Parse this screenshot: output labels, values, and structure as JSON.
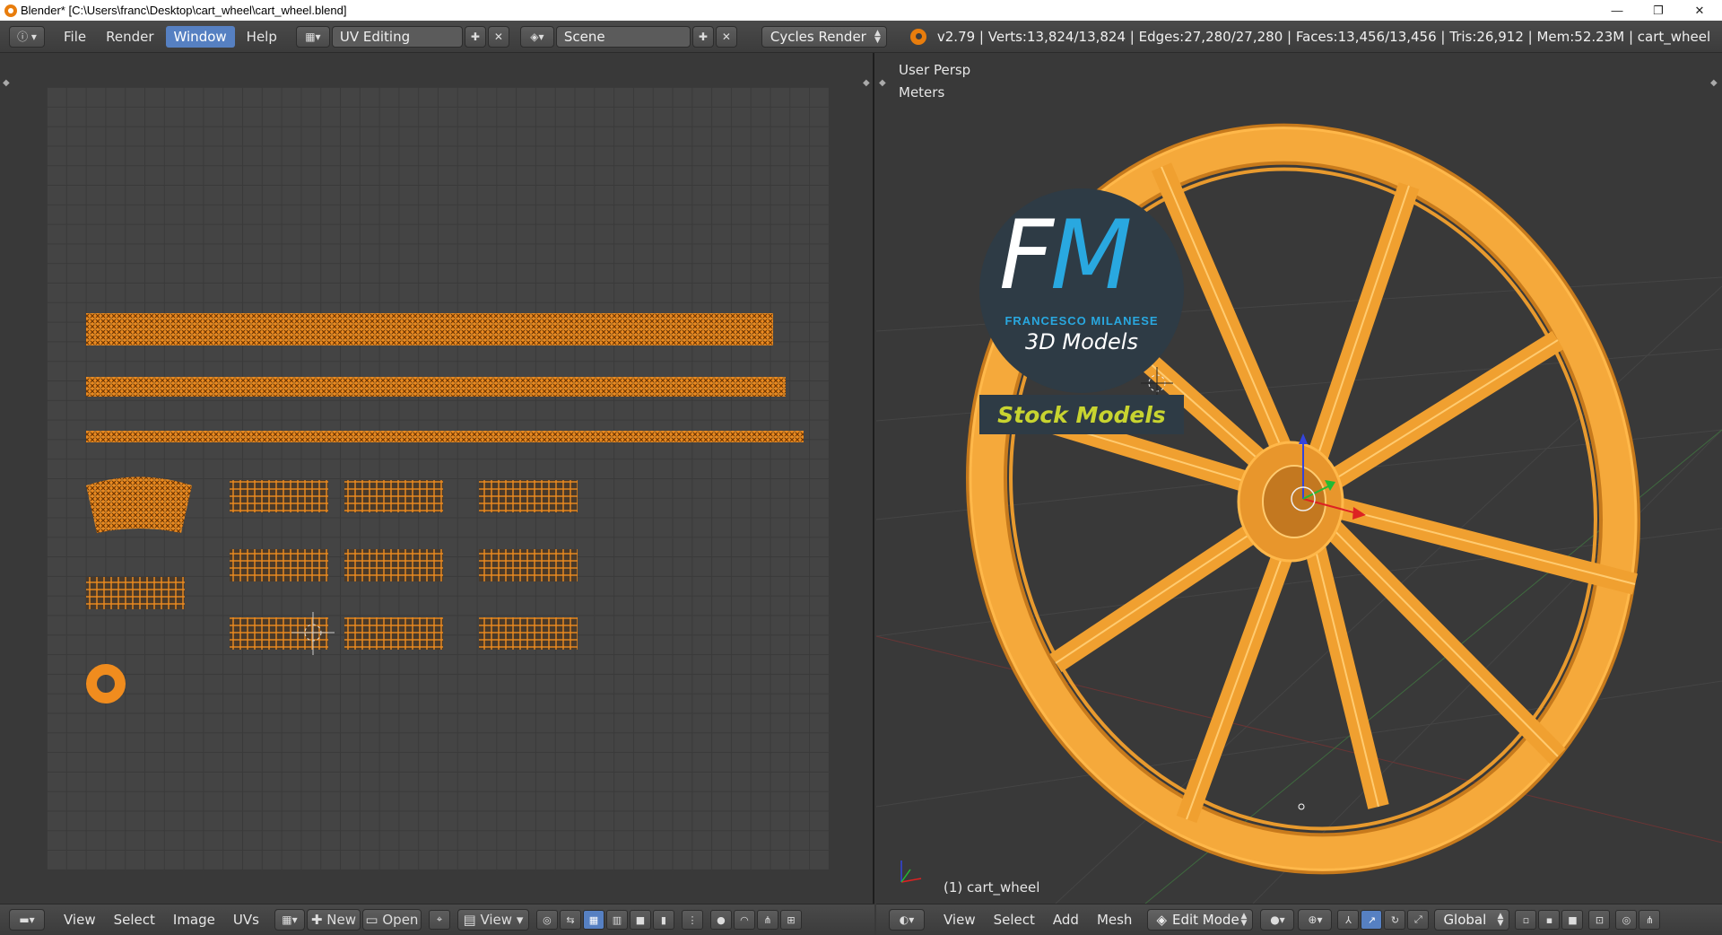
{
  "window": {
    "title": "Blender* [C:\\Users\\franc\\Desktop\\cart_wheel\\cart_wheel.blend]",
    "minimize": "—",
    "restore": "❐",
    "close": "✕"
  },
  "topbar": {
    "menus": [
      "File",
      "Render",
      "Window",
      "Help"
    ],
    "active_menu": "Window",
    "screen_layout": "UV Editing",
    "scene": "Scene",
    "render_engine": "Cycles Render",
    "stats": "v2.79 | Verts:13,824/13,824 | Edges:27,280/27,280 | Faces:13,456/13,456 | Tris:26,912 | Mem:52.23M | cart_wheel"
  },
  "uv_editor": {
    "bottom_menus": [
      "View",
      "Select",
      "Image",
      "UVs"
    ],
    "new_label": "New",
    "open_label": "Open",
    "view_label": "View"
  },
  "viewport": {
    "view_name": "User Persp",
    "units": "Meters",
    "object_label": "(1) cart_wheel",
    "bottom_menus": [
      "View",
      "Select",
      "Add",
      "Mesh"
    ],
    "mode": "Edit Mode",
    "orientation": "Global"
  },
  "watermark": {
    "monogram_f": "F",
    "monogram_m": "M",
    "author": "FRANCESCO MILANESE",
    "subtitle": "3D Models",
    "banner": "Stock Models"
  },
  "colors": {
    "accent": "#5680c2",
    "uv_orange": "#f08c1e",
    "mesh_orange": "#f0a030",
    "logo_blue": "#29a8e0",
    "banner_yellow": "#c8d430"
  }
}
